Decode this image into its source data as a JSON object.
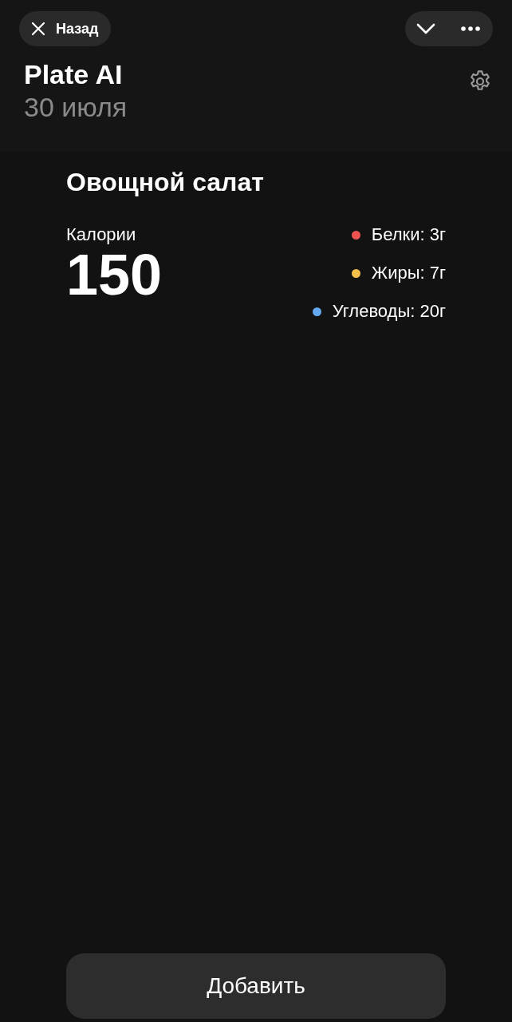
{
  "top_bar": {
    "back_label": "Назад"
  },
  "header": {
    "title": "Plate AI",
    "date": "30 июля"
  },
  "dish": {
    "name": "Овощной салат",
    "calories_label": "Калории",
    "calories": "150",
    "macros": [
      {
        "text": "Белки: 3г",
        "color": "#ef5350"
      },
      {
        "text": "Жиры: 7г",
        "color": "#f5c04a"
      },
      {
        "text": "Углеводы: 20г",
        "color": "#64a8f0"
      }
    ]
  },
  "add_button": "Добавить"
}
